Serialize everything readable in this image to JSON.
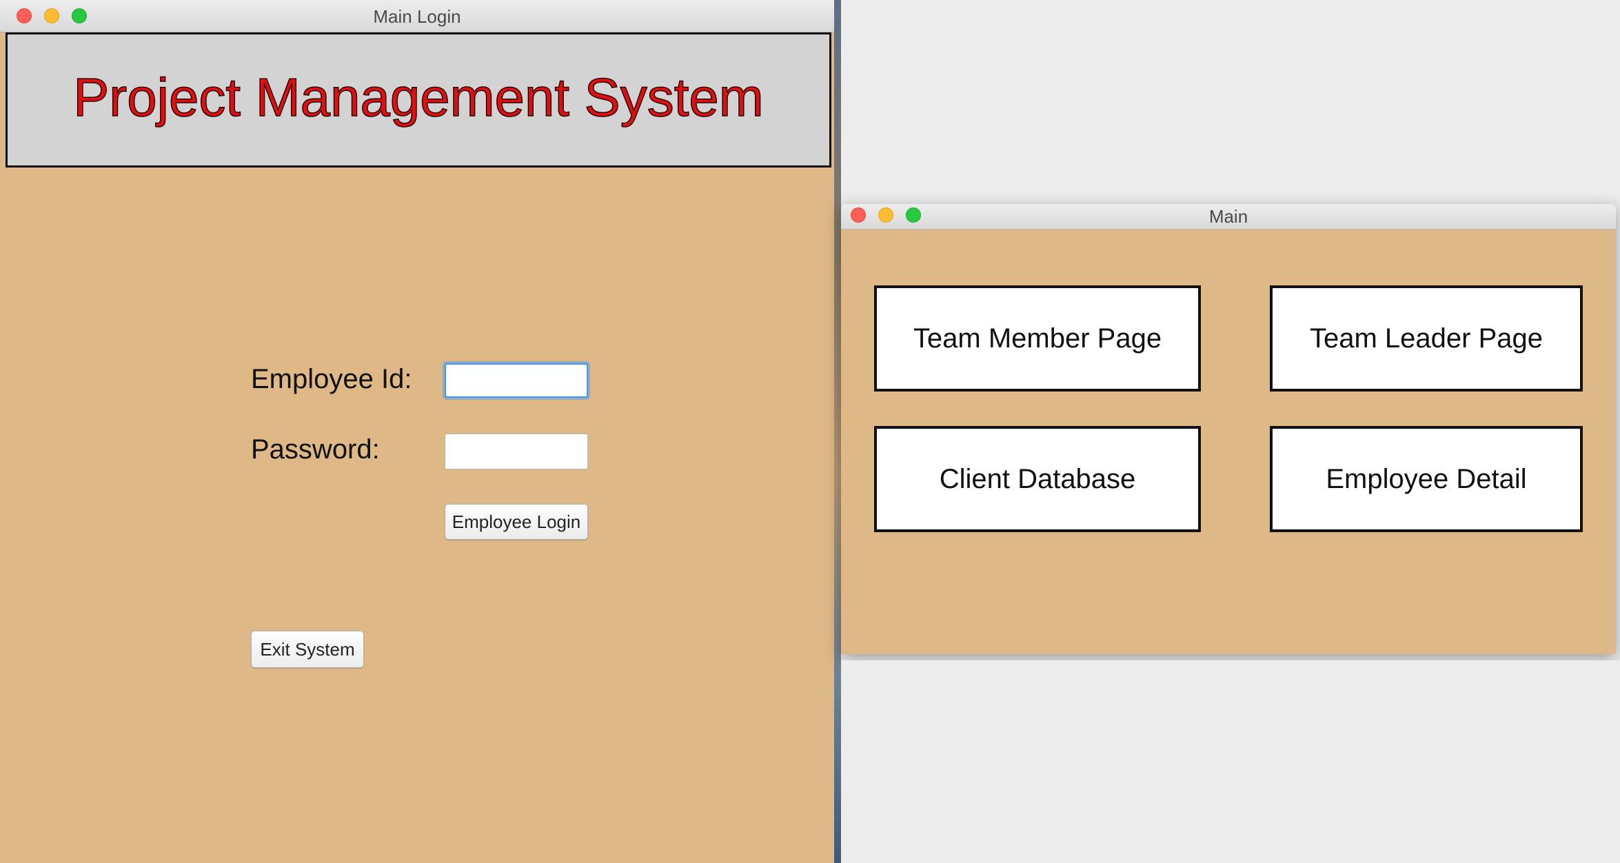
{
  "login_window": {
    "title": "Main Login",
    "header_title": "Project Management System",
    "employee_id_label": "Employee Id:",
    "employee_id_value": "",
    "password_label": "Password:",
    "password_value": "",
    "login_button": "Employee Login",
    "exit_button": "Exit System"
  },
  "main_window": {
    "title": "Main",
    "buttons": {
      "team_member": "Team Member Page",
      "team_leader": "Team Leader Page",
      "client_database": "Client Database",
      "employee_detail": "Employee Detail"
    }
  },
  "colors": {
    "panel_background": "#deb887",
    "header_background": "#d3d3d3",
    "header_text": "#dd1111",
    "focus_ring": "#3b99fc"
  }
}
